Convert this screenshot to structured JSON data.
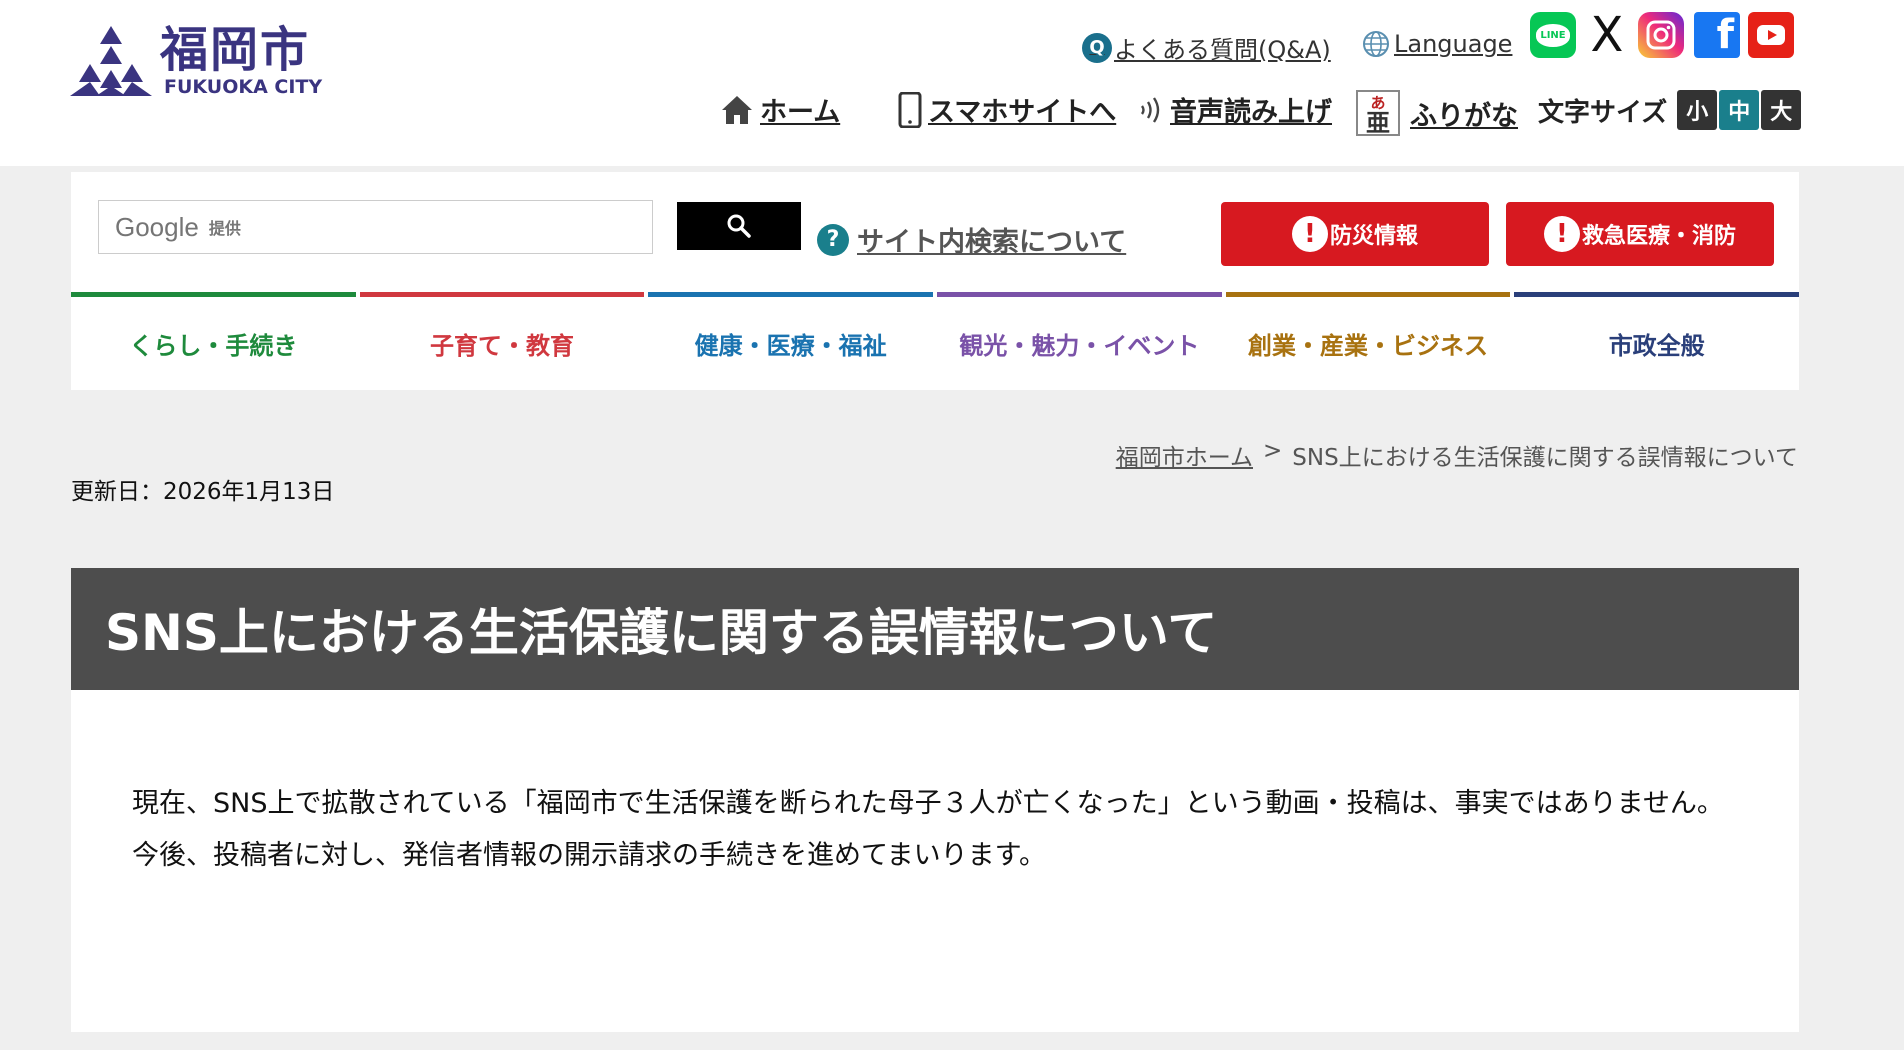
{
  "logo": {
    "name": "福岡市",
    "english": "FUKUOKA CITY"
  },
  "header": {
    "faq_label": "よくある質問(Q&A)",
    "language_label": "Language",
    "social": {
      "line_label": "LINE",
      "x_glyph": "X",
      "facebook_glyph": "f"
    },
    "nav": {
      "home": "ホーム",
      "mobile": "スマホサイトへ",
      "voice": "音声読み上げ",
      "furigana": "ふりがな",
      "furigana_icon_kana": "あ",
      "furigana_icon_kanji": "亜"
    },
    "font_size": {
      "label": "文字サイズ",
      "small": "小",
      "medium": "中",
      "large": "大"
    }
  },
  "search": {
    "google_label": "Google",
    "provided_label": "提供",
    "help_label": "サイト内検索について"
  },
  "alerts": {
    "disaster": "防災情報",
    "emergency": "救急医療・消防"
  },
  "global_nav": [
    {
      "label": "くらし・手続き",
      "color": "#1e8a3c"
    },
    {
      "label": "子育て・教育",
      "color": "#d0383f"
    },
    {
      "label": "健康・医療・福祉",
      "color": "#1a73b0"
    },
    {
      "label": "観光・魅力・イベント",
      "color": "#7a52a8"
    },
    {
      "label": "創業・産業・ビジネス",
      "color": "#a87210"
    },
    {
      "label": "市政全般",
      "color": "#2a3f7a"
    }
  ],
  "breadcrumb": {
    "home": "福岡市ホーム",
    "separator": ">",
    "current": "SNS上における生活保護に関する誤情報について"
  },
  "updated": "更新日：2026年1月13日",
  "page_title": "SNS上における生活保護に関する誤情報について",
  "article": {
    "para1": "　現在、SNS上で拡散されている「福岡市で生活保護を断られた母子３人が亡くなった」という動画・投稿は、事実ではありません。",
    "para2": "　今後、投稿者に対し、発信者情報の開示請求の手続きを進めてまいります。"
  },
  "colors": {
    "brand": "#3a3480",
    "alert_red": "#d71920",
    "teal": "#1a7f8c",
    "title_bar": "#4d4d4d"
  }
}
